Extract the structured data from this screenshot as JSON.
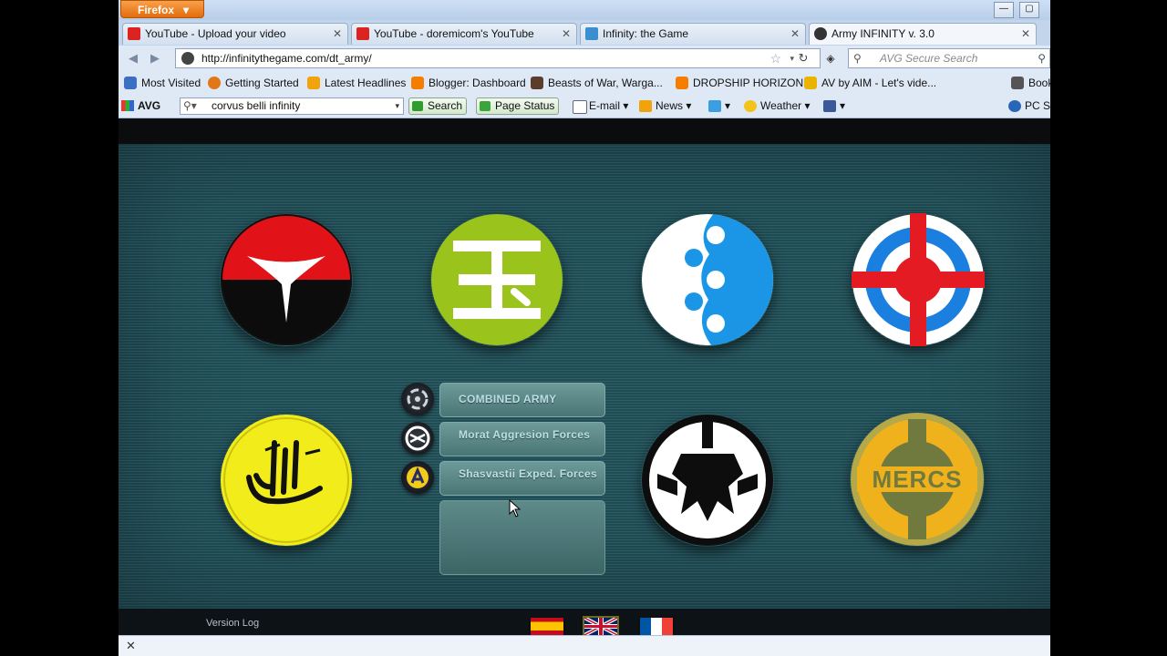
{
  "browser": {
    "menu_button": "Firefox",
    "menu_arrow": "▾",
    "window_controls": {
      "minimize": "—",
      "maximize": "▢",
      "close": "✕"
    }
  },
  "tabs": [
    {
      "label": "YouTube - Upload your video",
      "icon": "youtube-icon",
      "active": false
    },
    {
      "label": "YouTube - doremicom's YouTube",
      "icon": "youtube-icon",
      "active": false
    },
    {
      "label": "Infinity: the Game",
      "icon": "infinity-icon",
      "active": false
    },
    {
      "label": "Army INFINITY v. 3.0",
      "icon": "army-icon",
      "active": true
    }
  ],
  "tab_close": "✕",
  "nav": {
    "back": "◀",
    "forward": "▶",
    "url": "http://infinitythegame.com/dt_army/",
    "star": "☆",
    "dropdown": "▾",
    "reload": "↻",
    "search_placeholder": "AVG Secure Search",
    "search_icon": "⚲",
    "go_icon": "⚲"
  },
  "bookmarks": [
    {
      "label": "Most Visited",
      "icon": "most-visited-icon",
      "color": "#3b6fc2"
    },
    {
      "label": "Getting Started",
      "icon": "firefox-icon",
      "color": "#e2761b"
    },
    {
      "label": "Latest Headlines",
      "icon": "rss-icon",
      "color": "#f0a30a"
    },
    {
      "label": "Blogger: Dashboard",
      "icon": "blogger-icon",
      "color": "#f57d00"
    },
    {
      "label": "Beasts of War, Warga...",
      "icon": "beasts-icon",
      "color": "#5a3d2b"
    },
    {
      "label": "DROPSHIP HORIZON",
      "icon": "blogger-icon",
      "color": "#f57d00"
    },
    {
      "label": "AV by AIM - Let's vide...",
      "icon": "aim-icon",
      "color": "#e8b400"
    },
    {
      "label": "Book",
      "icon": "bookmarks-icon",
      "color": "#555555"
    }
  ],
  "avg_toolbar": {
    "logo": "AVG",
    "search_value": "corvus belli infinity",
    "search_button": "Search",
    "page_status": "Page Status",
    "email": "E-mail",
    "news": "News",
    "weather": "Weather",
    "pc": "PC S",
    "dropdown": "▾"
  },
  "factions": [
    {
      "name": "Panoceania",
      "icon": "panoceania-icon"
    },
    {
      "name": "Yu Jing",
      "icon": "yujing-icon"
    },
    {
      "name": "Ariadna",
      "icon": "ariadna-icon"
    },
    {
      "name": "Haqqislam",
      "icon": "haqqislam-icon"
    },
    {
      "name": "Nomads",
      "icon": "nomads-icon"
    },
    {
      "name": "Mercenaries",
      "icon": "mercs-icon",
      "text": "MERCS"
    }
  ],
  "ca_menu": {
    "items": [
      {
        "label": "COMBINED ARMY",
        "icon": "combined-army-icon"
      },
      {
        "label": "Morat Aggresion Forces",
        "icon": "morat-icon"
      },
      {
        "label": "Shasvastii Exped. Forces",
        "icon": "shasvastii-icon"
      }
    ]
  },
  "footer": {
    "version_log": "Version Log",
    "flags": [
      "spanish-flag",
      "english-flag",
      "french-flag"
    ]
  },
  "findbar": {
    "close": "✕"
  }
}
